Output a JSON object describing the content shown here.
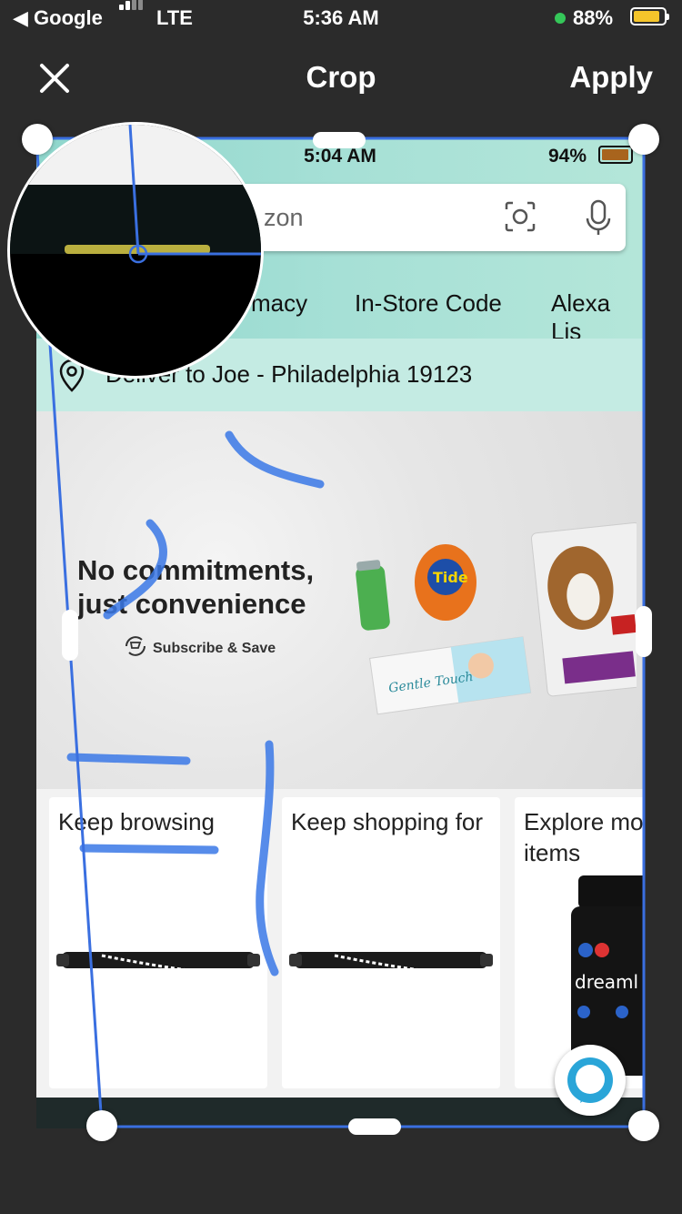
{
  "status_bar": {
    "back_app": "Google",
    "network": "LTE",
    "time": "5:36 AM",
    "battery": "88%",
    "battery_color": "#f5c52b"
  },
  "nav": {
    "close_icon": "close-icon",
    "title": "Crop",
    "apply_label": "Apply"
  },
  "screenshot": {
    "time": "5:04 AM",
    "battery": "94%",
    "search_placeholder_visible": "zon",
    "nav_links": [
      "macy",
      "In-Store Code",
      "Alexa Lis"
    ],
    "deliver": "Deliver to Joe - Philadelphia 19123",
    "banner": {
      "headline_line1": "No commitments,",
      "headline_line2": "just convenience",
      "subscribe": "Subscribe & Save"
    },
    "cards": [
      {
        "title": "Keep browsing"
      },
      {
        "title": "Keep shopping for"
      },
      {
        "title": "Explore mo items"
      }
    ]
  },
  "colors": {
    "crop_line": "#3a6fe0",
    "marker_scribble": "#3a78e6",
    "accent_teal": "#8fd6cc"
  }
}
